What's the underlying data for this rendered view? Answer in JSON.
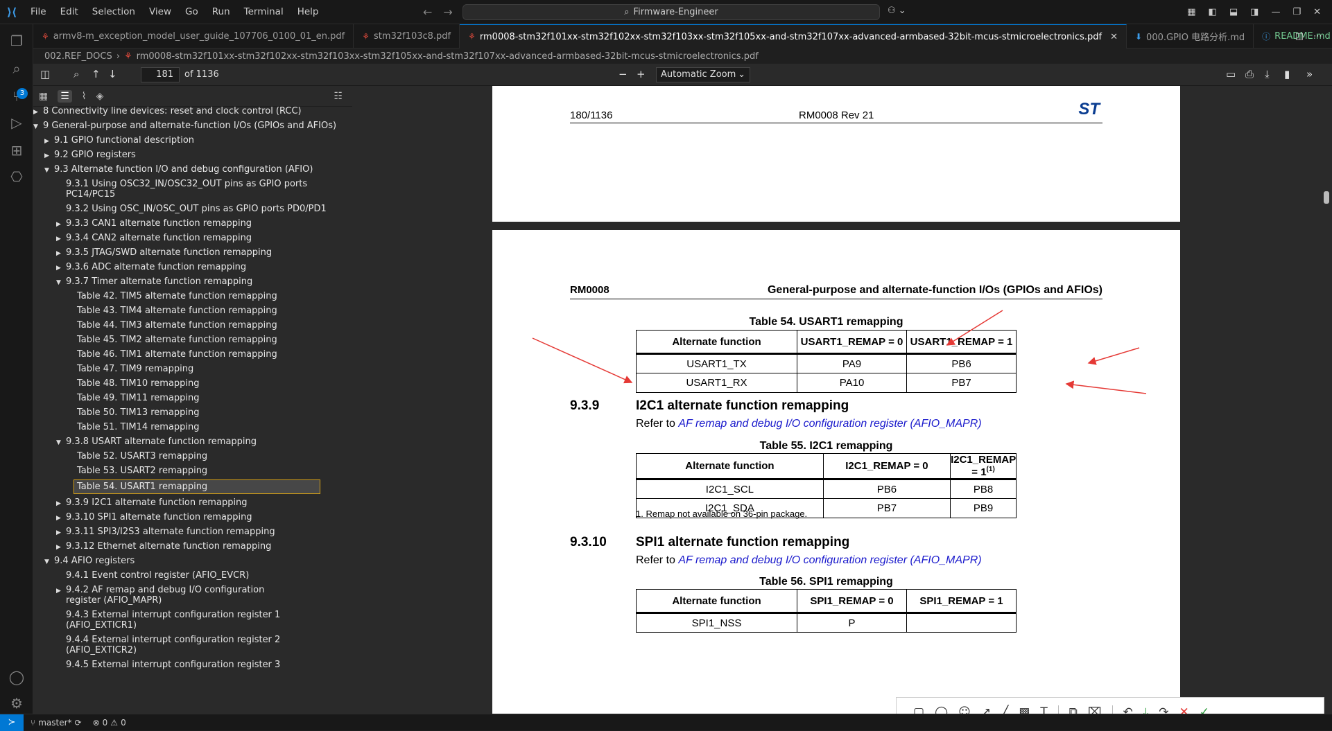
{
  "menu": [
    "File",
    "Edit",
    "Selection",
    "View",
    "Go",
    "Run",
    "Terminal",
    "Help"
  ],
  "search": {
    "label": "Firmware-Engineer"
  },
  "tabs": [
    {
      "label": "armv8-m_exception_model_user_guide_107706_0100_01_en.pdf"
    },
    {
      "label": "stm32f103c8.pdf"
    },
    {
      "label": "rm0008-stm32f101xx-stm32f102xx-stm32f103xx-stm32f105xx-and-stm32f107xx-advanced-armbased-32bit-mcus-stmicroelectronics.pdf"
    },
    {
      "label": "000.GPIO 电路分析.md"
    },
    {
      "label": "README.md",
      "status": "U"
    }
  ],
  "breadcrumb": {
    "folder": "002.REF_DOCS",
    "file": "rm0008-stm32f101xx-stm32f102xx-stm32f103xx-stm32f105xx-and-stm32f107xx-advanced-armbased-32bit-mcus-stmicroelectronics.pdf"
  },
  "pdf": {
    "page": "181",
    "of": "of 1136",
    "zoom": "Automatic Zoom"
  },
  "outline": [
    "8 Connectivity line devices: reset and clock control (RCC)",
    "9 General-purpose and alternate-function I/Os (GPIOs and AFIOs)",
    "9.1 GPIO functional description",
    "9.2 GPIO registers",
    "9.3 Alternate function I/O and debug configuration (AFIO)",
    "9.3.1 Using OSC32_IN/OSC32_OUT pins as GPIO ports PC14/PC15",
    "9.3.2 Using OSC_IN/OSC_OUT pins as GPIO ports PD0/PD1",
    "9.3.3 CAN1 alternate function remapping",
    "9.3.4 CAN2 alternate function remapping",
    "9.3.5 JTAG/SWD alternate function remapping",
    "9.3.6 ADC alternate function remapping",
    "9.3.7 Timer alternate function remapping",
    "Table 42. TIM5 alternate function remapping",
    "Table 43. TIM4 alternate function remapping",
    "Table 44. TIM3 alternate function remapping",
    "Table 45. TIM2 alternate function remapping",
    "Table 46. TIM1 alternate function remapping",
    "Table 47. TIM9 remapping",
    "Table 48. TIM10 remapping",
    "Table 49. TIM11 remapping",
    "Table 50. TIM13 remapping",
    "Table 51. TIM14 remapping",
    "9.3.8 USART alternate function remapping",
    "Table 52. USART3 remapping",
    "Table 53. USART2 remapping",
    "Table 54. USART1 remapping",
    "9.3.9 I2C1 alternate function remapping",
    "9.3.10 SPI1 alternate function remapping",
    "9.3.11 SPI3/I2S3 alternate function remapping",
    "9.3.12 Ethernet alternate function remapping",
    "9.4 AFIO registers",
    "9.4.1 Event control register (AFIO_EVCR)",
    "9.4.2 AF remap and debug I/O configuration register (AFIO_MAPR)",
    "9.4.3 External interrupt configuration register 1 (AFIO_EXTICR1)",
    "9.4.4 External interrupt configuration register 2 (AFIO_EXTICR2)",
    "9.4.5 External interrupt configuration register 3"
  ],
  "doc": {
    "page1_header": {
      "left": "180/1136",
      "center": "RM0008 Rev 21",
      "logo": "ST"
    },
    "page2_header": {
      "left": "RM0008",
      "right": "General-purpose and alternate-function I/Os (GPIOs and AFIOs)"
    },
    "table54": {
      "caption": "Table 54. USART1 remapping",
      "headers": [
        "Alternate function",
        "USART1_REMAP = 0",
        "USART1_REMAP = 1"
      ],
      "rows": [
        [
          "USART1_TX",
          "PA9",
          "PB6"
        ],
        [
          "USART1_RX",
          "PA10",
          "PB7"
        ]
      ]
    },
    "sec939": {
      "num": "9.3.9",
      "title": "I2C1 alternate function remapping",
      "refer": "Refer to ",
      "link": "AF remap and debug I/O configuration register (AFIO_MAPR)"
    },
    "table55": {
      "caption": "Table 55. I2C1 remapping",
      "headers": [
        "Alternate function",
        "I2C1_REMAP = 0",
        "I2C1_REMAP = 1"
      ],
      "sup": "(1)",
      "rows": [
        [
          "I2C1_SCL",
          "PB6",
          "PB8"
        ],
        [
          "I2C1_SDA",
          "PB7",
          "PB9"
        ]
      ],
      "footnote": "1.   Remap not available on 36-pin package."
    },
    "sec9310": {
      "num": "9.3.10",
      "title": "SPI1 alternate function remapping",
      "refer": "Refer to ",
      "link": "AF remap and debug I/O configuration register (AFIO_MAPR)"
    },
    "table56": {
      "caption": "Table 56. SPI1 remapping",
      "headers": [
        "Alternate function",
        "SPI1_REMAP = 0",
        "SPI1_REMAP = 1"
      ],
      "rows": [
        [
          "SPI1_NSS",
          "P",
          ""
        ]
      ]
    }
  },
  "status": {
    "branch": "master*",
    "problems": "0",
    "warnings": "0"
  },
  "colors": {
    "accent": "#0078d4",
    "annotation_arrow": "#e53935",
    "link": "#1a1acc"
  }
}
